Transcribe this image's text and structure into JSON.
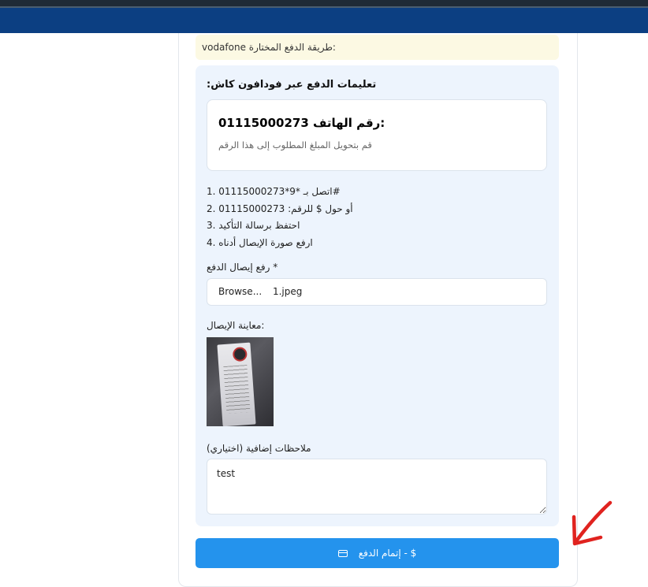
{
  "payment_method": {
    "label": "طريقة الدفع المختارة:",
    "value": "vodafone"
  },
  "instructions": {
    "title": ":تعليمات الدفع عبر فودافون كاش",
    "phone_label": "رقم الهاتف:",
    "phone_number": "01115000273",
    "phone_hint": "قم بتحويل المبلغ المطلوب إلى هذا الرقم",
    "steps": [
      {
        "num": "1.",
        "text": "اتصل بـ *9*01115000273#"
      },
      {
        "num": "2.",
        "text": "أو حول $ للرقم: 01115000273"
      },
      {
        "num": "3.",
        "text": "احتفظ برسالة التأكيد"
      },
      {
        "num": "4.",
        "text": "ارفع صورة الإيصال أدناه"
      }
    ]
  },
  "upload": {
    "label": "رفع إيصال الدفع *",
    "browse_label": "Browse...",
    "file_name": "1.jpeg"
  },
  "preview": {
    "label": "معاينة الإيصال:"
  },
  "notes": {
    "label": "ملاحظات إضافية (اختياري)",
    "value": "test"
  },
  "submit": {
    "label": "إتمام الدفع - $",
    "icon": "credit-card-icon"
  },
  "colors": {
    "header_blue": "#0c3f82",
    "button_blue": "#2493ed",
    "note_bg": "#fcf9e3",
    "panel_bg": "#edf4fd",
    "annotation_red": "#e0231f"
  }
}
